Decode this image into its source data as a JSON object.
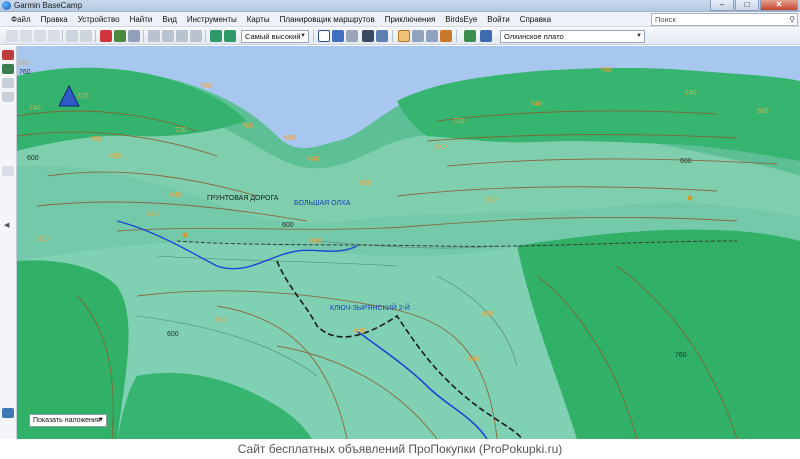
{
  "window": {
    "title": "Garmin BaseCamp",
    "minimize": "–",
    "maximize": "□",
    "close": "✕"
  },
  "menu": {
    "items": [
      "Файл",
      "Правка",
      "Устройство",
      "Найти",
      "Вид",
      "Инструменты",
      "Карты",
      "Планировщик маршрутов",
      "Приключения",
      "BirdsEye",
      "Войти",
      "Справка"
    ]
  },
  "search": {
    "placeholder": "Поиск",
    "icon": "magnifier-icon"
  },
  "toolbar": {
    "detail_select": "Самый высокий",
    "map_select": "Олхинское плато"
  },
  "map": {
    "overlay_select": "Показать наложения",
    "labels": {
      "elev_760_a": "760",
      "elev_760_b": "760",
      "elev_740_a": "740",
      "elev_740_b": "740",
      "elev_740_c": "740",
      "elev_720_a": "720",
      "elev_720_b": "720",
      "elev_720_c": "720",
      "elev_700_a": "700",
      "elev_700_b": "700",
      "elev_680_a": "680",
      "elev_680_b": "680",
      "elev_680_c": "680",
      "elev_660_a": "660",
      "elev_660_b": "660",
      "elev_640_a": "640",
      "elev_640_b": "640",
      "elev_640_c": "640",
      "elev_620": "620",
      "elev_620_b": "620",
      "elev_600_a": "600",
      "elev_600_b": "600",
      "elev_600_c": "600",
      "elev_600_d": "600",
      "elev_600_e": "600",
      "elev_780": "780",
      "elev_760_c": "760",
      "road_name": "ГРУНТОВАЯ ДОРОГА",
      "river_1": "БОЛЬШАЯ ОЛХА",
      "river_2": "КЛЮЧ-ЗЫРЯНСКИЙ 2-Й"
    }
  },
  "footer": {
    "text": "Сайт бесплатных объявлений ПроПокупки (ProPokupki.ru)"
  },
  "colors": {
    "sky": "#a8c7ee",
    "terrain": "#6fc7a7",
    "forest": "#35b56f",
    "contour": "#8b5a2b",
    "river": "#1f47d6"
  }
}
